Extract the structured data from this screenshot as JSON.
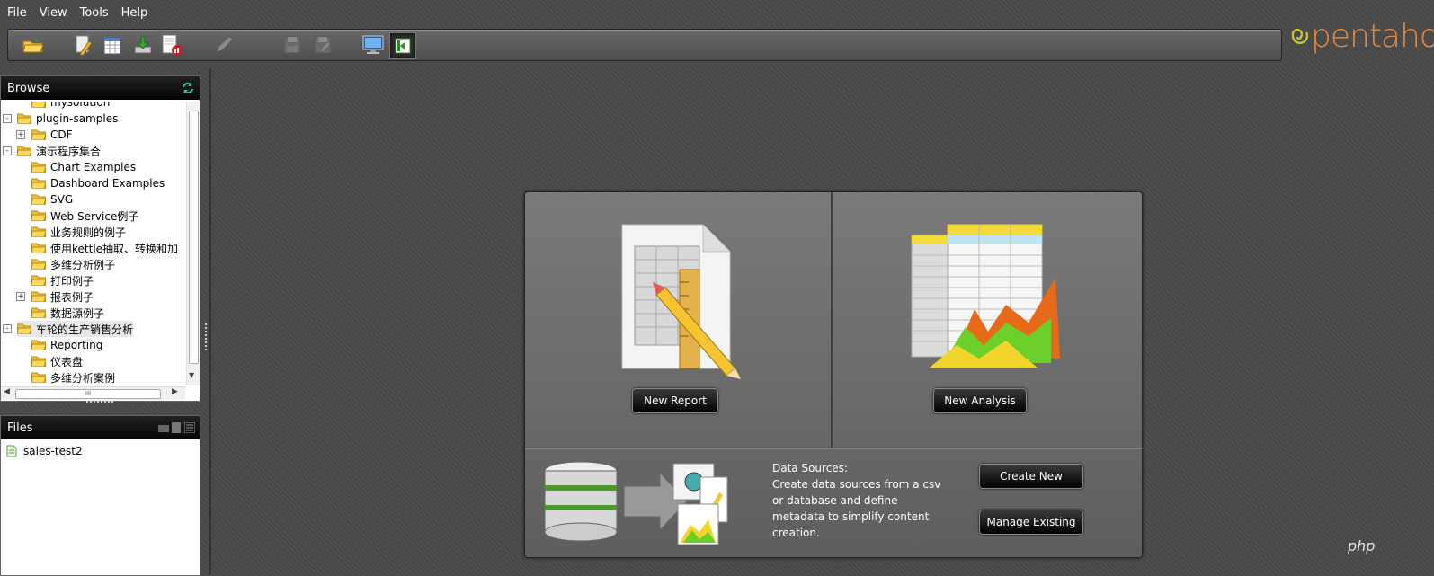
{
  "menu": [
    "File",
    "View",
    "Tools",
    "Help"
  ],
  "logo": {
    "text": "pentaho",
    "color": "#e9873b"
  },
  "toolbar_icons": [
    "open-folder-icon",
    "edit-report-icon",
    "calendar-icon",
    "download-icon",
    "report-icon",
    "pencil-icon",
    "save-icon",
    "save-as-icon",
    "monitor-icon",
    "workspace-icon"
  ],
  "browse": {
    "title": "Browse",
    "tree": [
      {
        "label": "mysolution",
        "level": 1,
        "expander": ""
      },
      {
        "label": "plugin-samples",
        "level": 0,
        "expander": "-"
      },
      {
        "label": "CDF",
        "level": 1,
        "expander": "+"
      },
      {
        "label": "演示程序集合",
        "level": 0,
        "expander": "-"
      },
      {
        "label": "Chart Examples",
        "level": 1,
        "expander": ""
      },
      {
        "label": "Dashboard Examples",
        "level": 1,
        "expander": ""
      },
      {
        "label": "SVG",
        "level": 1,
        "expander": ""
      },
      {
        "label": "Web Service例子",
        "level": 1,
        "expander": ""
      },
      {
        "label": "业务规则的例子",
        "level": 1,
        "expander": ""
      },
      {
        "label": "使用kettle抽取、转换和加",
        "level": 1,
        "expander": ""
      },
      {
        "label": "多维分析例子",
        "level": 1,
        "expander": ""
      },
      {
        "label": "打印例子",
        "level": 1,
        "expander": ""
      },
      {
        "label": "报表例子",
        "level": 1,
        "expander": "+"
      },
      {
        "label": "数据源例子",
        "level": 1,
        "expander": ""
      },
      {
        "label": "车轮的生产销售分析",
        "level": 0,
        "expander": "-",
        "selected": true
      },
      {
        "label": "Reporting",
        "level": 1,
        "expander": ""
      },
      {
        "label": "仪表盘",
        "level": 1,
        "expander": ""
      },
      {
        "label": "多维分析案例",
        "level": 1,
        "expander": ""
      }
    ],
    "hscroll_label": "III"
  },
  "files": {
    "title": "Files",
    "items": [
      "sales-test2"
    ]
  },
  "launch": {
    "new_report": "New Report",
    "new_analysis": "New Analysis",
    "ds_title": "Data Sources:",
    "ds_desc": "Create data sources from a csv or database and define metadata to simplify content creation.",
    "create_new": "Create New",
    "manage_existing": "Manage Existing"
  },
  "watermark": "php"
}
